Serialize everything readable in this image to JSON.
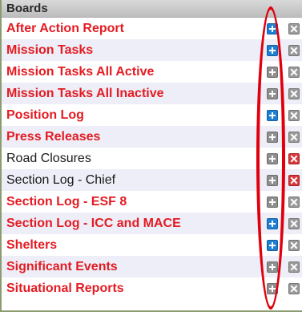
{
  "panel": {
    "title": "Boards"
  },
  "colors": {
    "active_label": "#e41b22",
    "inactive_label": "#1a1a1a",
    "add_blue": "#1f7fd3",
    "add_gray": "#8f8f8f",
    "delete_gray": "#9a9a9a",
    "delete_red": "#d9363b",
    "highlight_oval": "#e0000d"
  },
  "boards": [
    {
      "label": "After Action Report",
      "style": "active",
      "add_icon": "add-blue",
      "delete_icon": "delete-gray"
    },
    {
      "label": "Mission Tasks",
      "style": "active",
      "add_icon": "add-blue",
      "delete_icon": "delete-gray"
    },
    {
      "label": "Mission Tasks All Active",
      "style": "active",
      "add_icon": "add-gray",
      "delete_icon": "delete-gray"
    },
    {
      "label": "Mission Tasks All Inactive",
      "style": "active",
      "add_icon": "add-gray",
      "delete_icon": "delete-gray"
    },
    {
      "label": "Position Log",
      "style": "active",
      "add_icon": "add-blue",
      "delete_icon": "delete-gray"
    },
    {
      "label": "Press Releases",
      "style": "active",
      "add_icon": "add-gray",
      "delete_icon": "delete-gray"
    },
    {
      "label": "Road Closures",
      "style": "inactive",
      "add_icon": "add-gray",
      "delete_icon": "delete-red"
    },
    {
      "label": "Section Log - Chief",
      "style": "inactive",
      "add_icon": "add-gray",
      "delete_icon": "delete-red"
    },
    {
      "label": "Section Log - ESF 8",
      "style": "active",
      "add_icon": "add-gray",
      "delete_icon": "delete-gray"
    },
    {
      "label": "Section Log - ICC and MACE",
      "style": "active",
      "add_icon": "add-blue",
      "delete_icon": "delete-gray"
    },
    {
      "label": "Shelters",
      "style": "active",
      "add_icon": "add-blue",
      "delete_icon": "delete-gray"
    },
    {
      "label": "Significant Events",
      "style": "active",
      "add_icon": "add-gray",
      "delete_icon": "delete-gray"
    },
    {
      "label": "Situational Reports",
      "style": "active",
      "add_icon": "add-gray",
      "delete_icon": "delete-gray"
    }
  ]
}
